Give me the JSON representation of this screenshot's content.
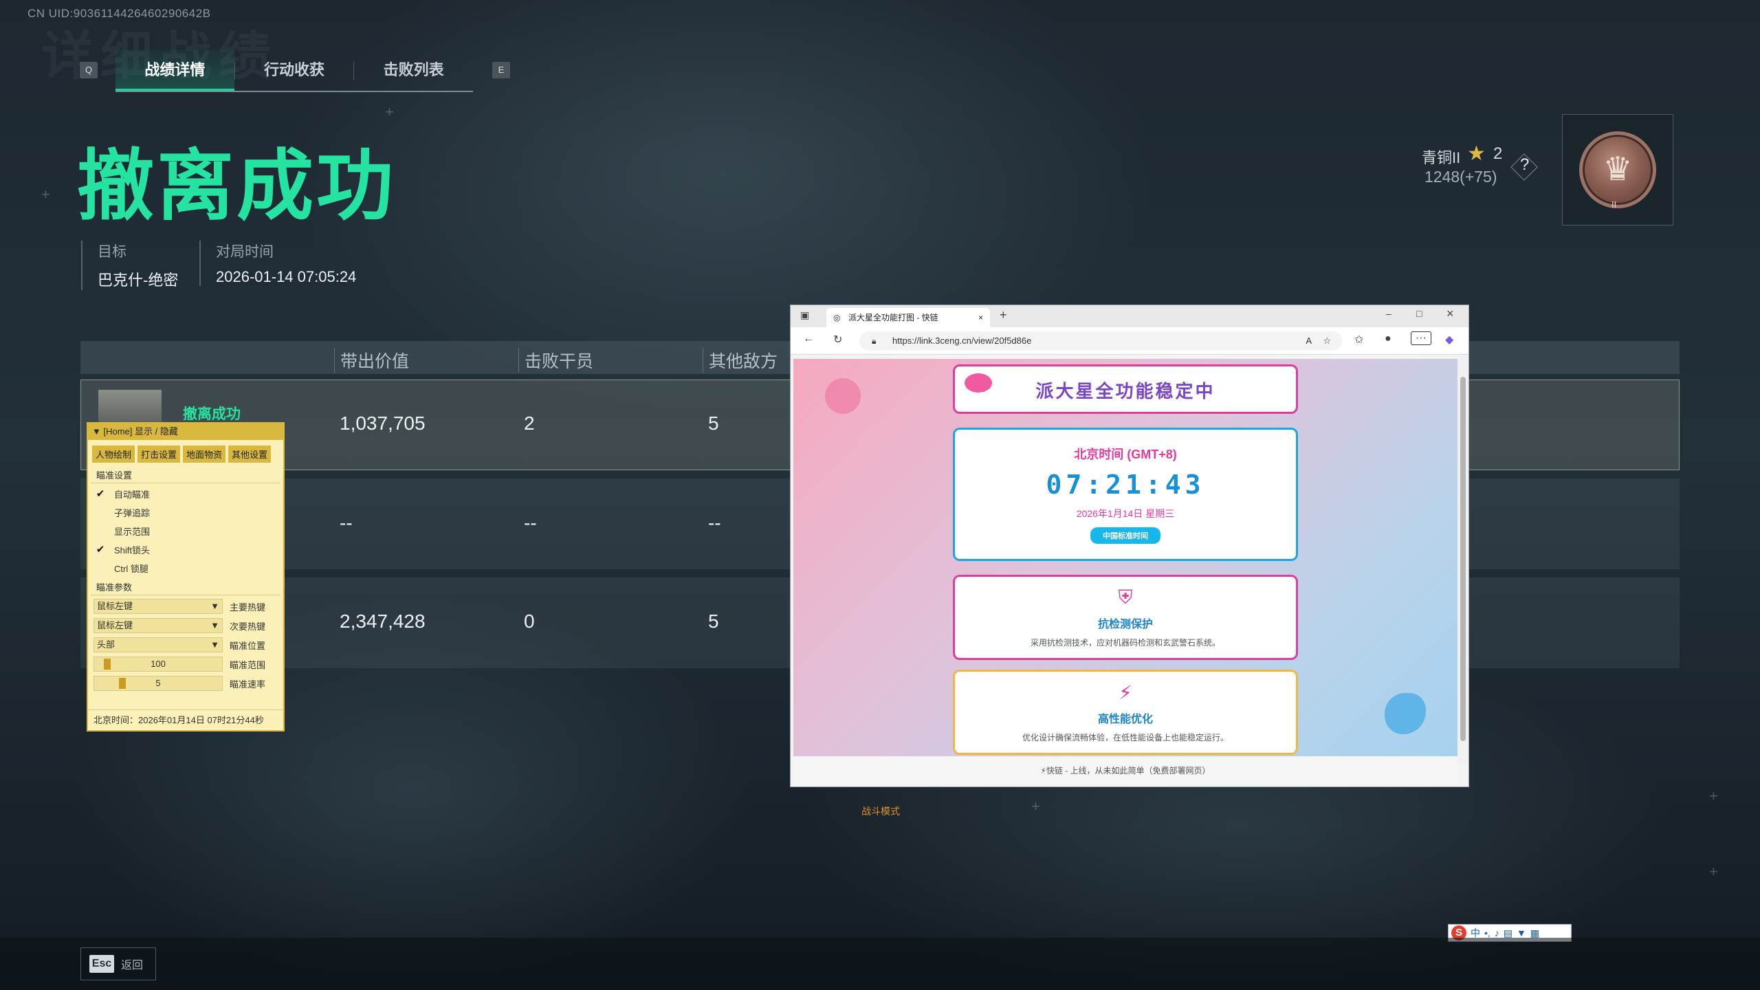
{
  "uid": "CN UID:9036114426460290642B",
  "ghost_title": "详细战绩",
  "tabs": {
    "left_key": "Q",
    "right_key": "E",
    "items": [
      "战绩详情",
      "行动收获",
      "击败列表"
    ]
  },
  "result_title": "撤离成功",
  "info": {
    "target_label": "目标",
    "target_value": "巴克什-绝密",
    "time_label": "对局时间",
    "time_value": "2026-01-14 07:05:24"
  },
  "rank": {
    "name": "青铜II",
    "stars": "2",
    "score": "1248(+75)",
    "help": "?",
    "badge_roman": "II"
  },
  "table": {
    "headers": [
      "带出价值",
      "击败干员",
      "其他敌方"
    ],
    "rows": [
      {
        "status": "撤离成功",
        "value": "1,037,705",
        "kills": "2",
        "others": "5"
      },
      {
        "status": "",
        "value": "--",
        "kills": "--",
        "others": "--"
      },
      {
        "status": "",
        "value": "2,347,428",
        "kills": "0",
        "others": "5"
      }
    ]
  },
  "mode_label": "战斗模式",
  "overlay": {
    "header": "[Home] 显示 / 隐藏",
    "tabs": [
      "人物绘制",
      "打击设置",
      "地面物资",
      "其他设置"
    ],
    "section1": "瞄准设置",
    "checks": [
      {
        "label": "自动瞄准",
        "checked": true
      },
      {
        "label": "子弹追踪",
        "checked": false
      },
      {
        "label": "显示范围",
        "checked": false
      },
      {
        "label": "Shift锁头",
        "checked": true
      },
      {
        "label": "Ctrl 锁腿",
        "checked": false
      }
    ],
    "section2": "瞄准参数",
    "selects": [
      {
        "value": "鼠标左键",
        "label": "主要热键"
      },
      {
        "value": "鼠标左键",
        "label": "次要热键"
      },
      {
        "value": "头部",
        "label": "瞄准位置"
      }
    ],
    "sliders": [
      {
        "value": "100",
        "label": "瞄准范围"
      },
      {
        "value": "5",
        "label": "瞄准速率"
      }
    ],
    "footer": "北京时间：2026年01月14日 07时21分44秒"
  },
  "browser": {
    "tab_title": "派大星全功能打图 - 快链",
    "url": "https://link.3ceng.cn/view/20f5d86e",
    "banner": "派大星全功能稳定中",
    "time_label": "北京时间 (GMT+8)",
    "time_value": "07:21:43",
    "date_value": "2026年1月14日 星期三",
    "std_button": "中国标准时间",
    "feature1_title": "抗检测保护",
    "feature1_desc": "采用抗检测技术，应对机器码检测和玄武警石系统。",
    "feature2_title": "高性能优化",
    "feature2_desc": "优化设计确保流畅体验，在低性能设备上也能稳定运行。",
    "footer": "快链 - 上线，从未如此简单（免费部署网页）"
  },
  "ime": {
    "logo": "S",
    "mode": "中"
  },
  "esc": {
    "key": "Esc",
    "label": "返回"
  },
  "colors": {
    "accent": "#25e3a0",
    "overlay_bg": "#fbf1b8",
    "overlay_accent": "#d9b93d"
  }
}
